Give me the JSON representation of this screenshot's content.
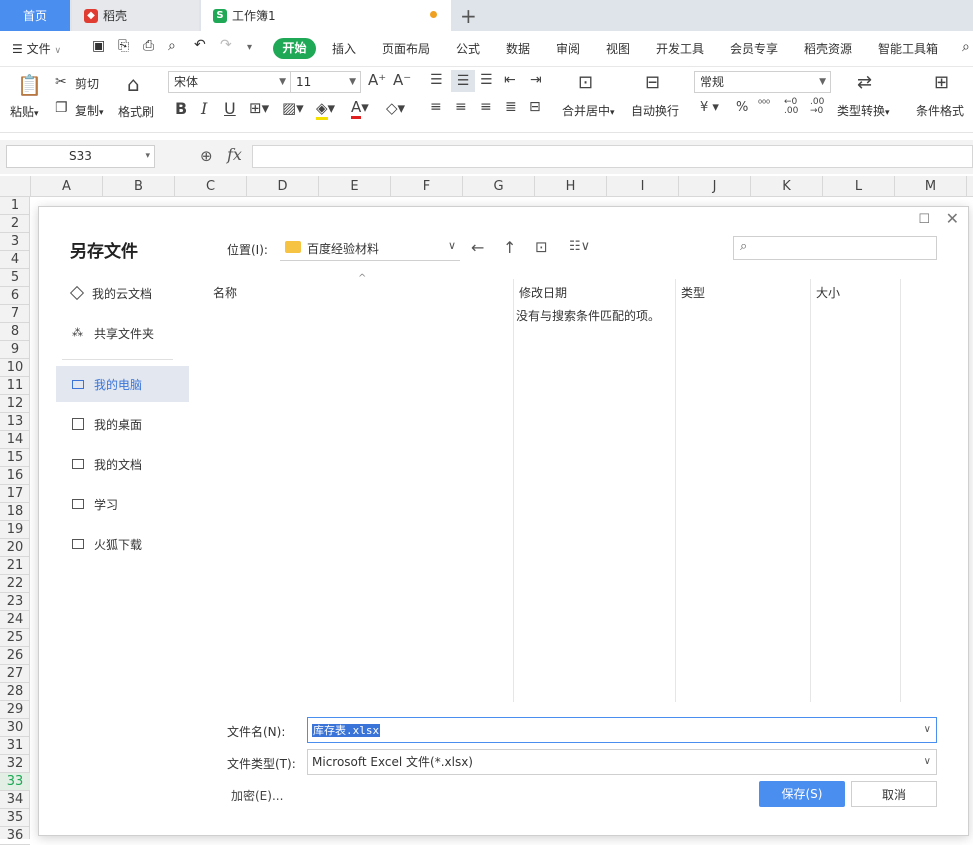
{
  "tabs": {
    "home": "首页",
    "docer": "稻壳",
    "workbook": "工作簿1"
  },
  "menu": {
    "file": "文件",
    "start": "开始",
    "items": [
      "插入",
      "页面布局",
      "公式",
      "数据",
      "审阅",
      "视图",
      "开发工具",
      "会员专享",
      "稻壳资源",
      "智能工具箱"
    ]
  },
  "ribbon": {
    "paste": "粘贴",
    "cut": "剪切",
    "copy": "复制",
    "format_painter": "格式刷",
    "font": "宋体",
    "size": "11",
    "merge": "合并居中",
    "wrap": "自动换行",
    "number_format": "常规",
    "type_convert": "类型转换",
    "cond_format": "条件格式"
  },
  "formula_bar": {
    "cell_ref": "S33",
    "fx": "fx"
  },
  "columns": [
    "A",
    "B",
    "C",
    "D",
    "E",
    "F",
    "G",
    "H",
    "I",
    "J",
    "K",
    "L",
    "M"
  ],
  "rows": [
    "1",
    "2",
    "3",
    "4",
    "5",
    "6",
    "7",
    "8",
    "9",
    "10",
    "11",
    "12",
    "13",
    "14",
    "15",
    "16",
    "17",
    "18",
    "19",
    "20",
    "21",
    "22",
    "23",
    "24",
    "25",
    "26",
    "27",
    "28",
    "29",
    "30",
    "31",
    "32",
    "33",
    "34",
    "35",
    "36"
  ],
  "active_row": "33",
  "dialog": {
    "title": "另存文件",
    "location_label": "位置(I):",
    "location_value": "百度经验材料",
    "sidebar": [
      {
        "label": "我的云文档",
        "icon": "cloud-cube-icon"
      },
      {
        "label": "共享文件夹",
        "icon": "share-folder-icon"
      },
      {
        "label": "我的电脑",
        "icon": "computer-icon",
        "active": true
      },
      {
        "label": "我的桌面",
        "icon": "desktop-icon"
      },
      {
        "label": "我的文档",
        "icon": "folder-icon"
      },
      {
        "label": "学习",
        "icon": "folder-icon"
      },
      {
        "label": "火狐下载",
        "icon": "folder-icon"
      }
    ],
    "columns": {
      "name": "名称",
      "modified": "修改日期",
      "type": "类型",
      "size": "大小"
    },
    "empty_message": "没有与搜索条件匹配的项。",
    "filename_label": "文件名(N):",
    "filename_value": "库存表.xlsx",
    "filetype_label": "文件类型(T):",
    "filetype_value": "Microsoft Excel 文件(*.xlsx)",
    "encrypt": "加密(E)...",
    "save": "保存(S)",
    "cancel": "取消"
  },
  "colors": {
    "accent": "#1fa855",
    "home_tab": "#4a8ef0",
    "save_button": "#4a8ef0",
    "selection": "#3a74d8"
  }
}
